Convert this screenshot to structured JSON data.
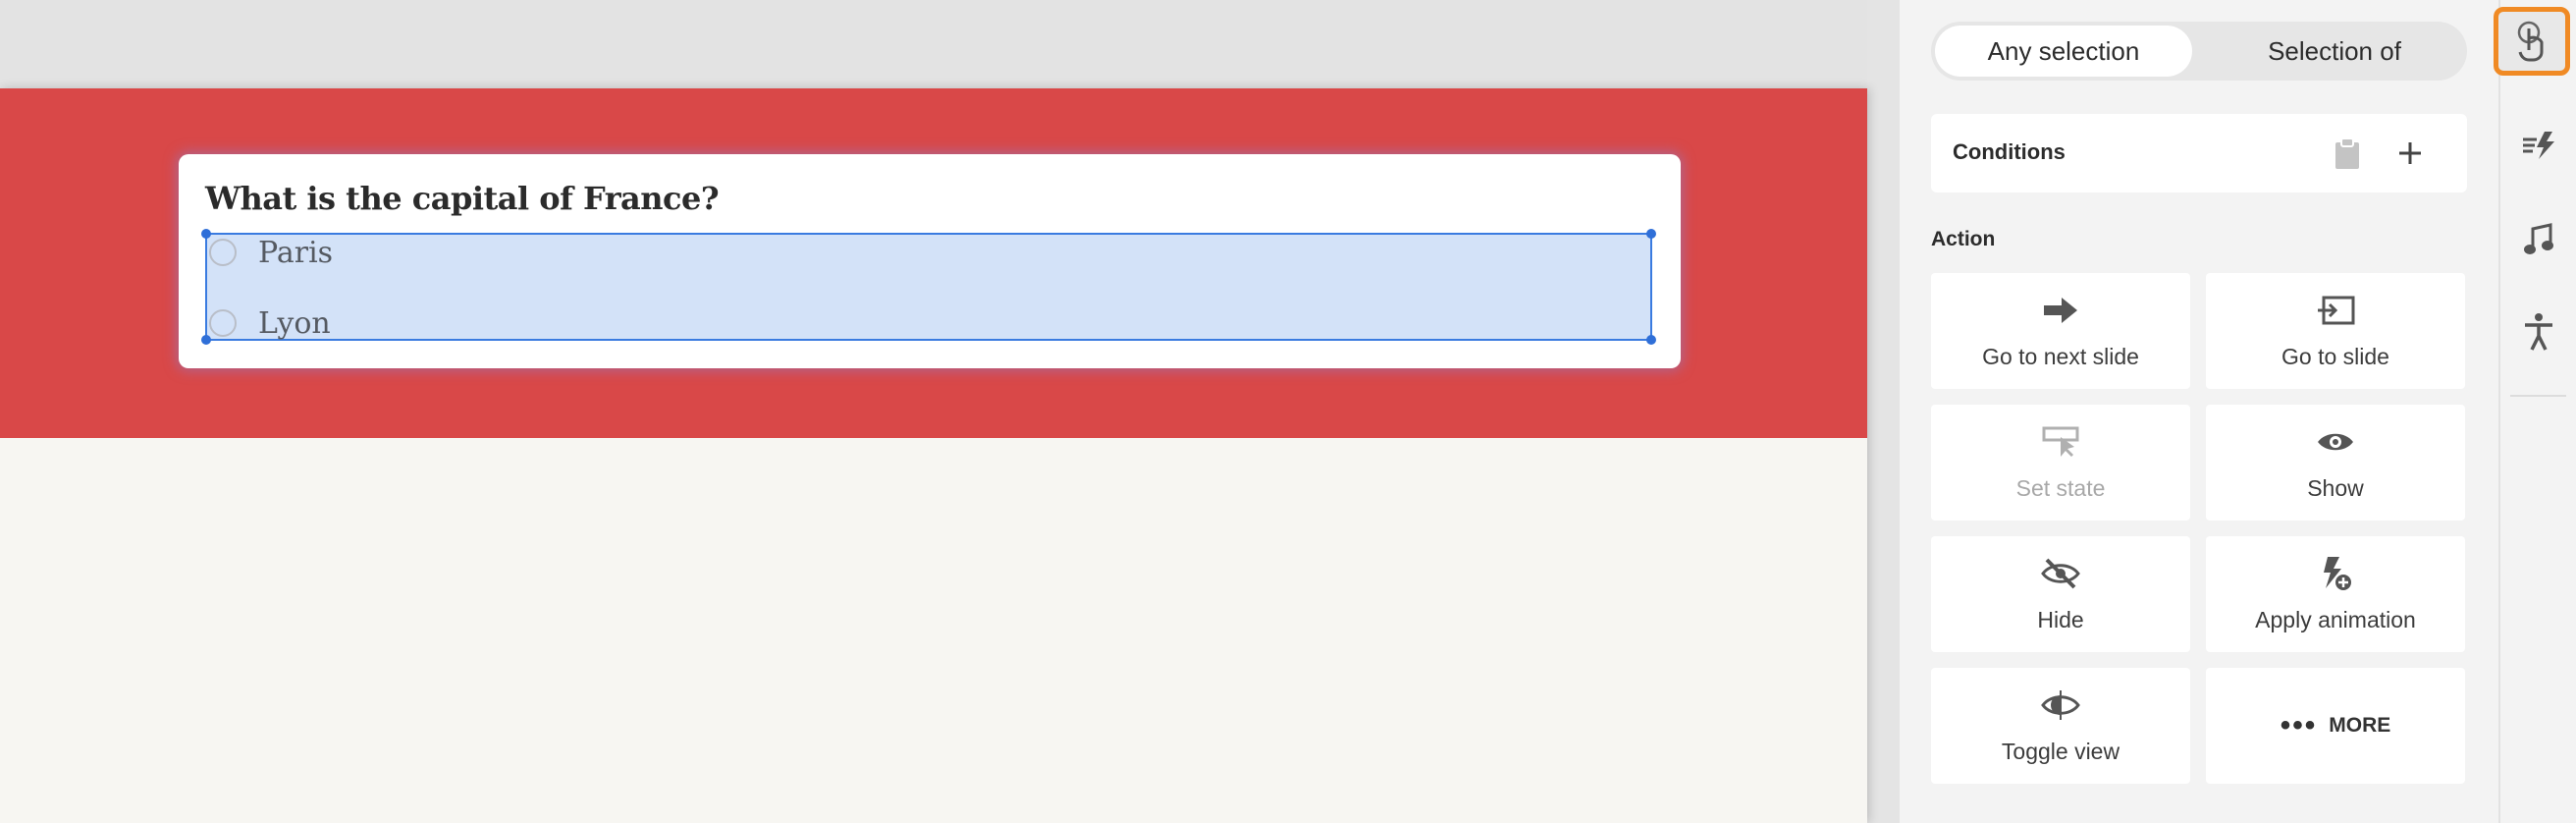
{
  "question": {
    "title": "What is the capital of France?",
    "options": [
      "Paris",
      "Lyon"
    ]
  },
  "panel": {
    "segments": {
      "active": "Any selection",
      "inactive": "Selection of"
    },
    "conditions_label": "Conditions",
    "action_label": "Action",
    "actions": [
      {
        "label": "Go to next slide",
        "icon": "arrow-right-icon",
        "enabled": true
      },
      {
        "label": "Go to slide",
        "icon": "enter-slide-icon",
        "enabled": true
      },
      {
        "label": "Set state",
        "icon": "set-state-icon",
        "enabled": false
      },
      {
        "label": "Show",
        "icon": "eye-icon",
        "enabled": true
      },
      {
        "label": "Hide",
        "icon": "eye-slash-icon",
        "enabled": true
      },
      {
        "label": "Apply animation",
        "icon": "animation-bolt-icon",
        "enabled": true
      },
      {
        "label": "Toggle view",
        "icon": "toggle-view-icon",
        "enabled": true
      },
      {
        "label": "MORE",
        "icon": "more-dots-icon",
        "enabled": true
      }
    ]
  },
  "rail": [
    "interaction-touch-icon",
    "animation-icon",
    "audio-note-icon",
    "accessibility-icon"
  ],
  "colors": {
    "slide_band": "#d94848",
    "selection_fill": "#d3e2f8",
    "selection_border": "#3a7be0",
    "active_rail_outline": "#f08a24"
  }
}
